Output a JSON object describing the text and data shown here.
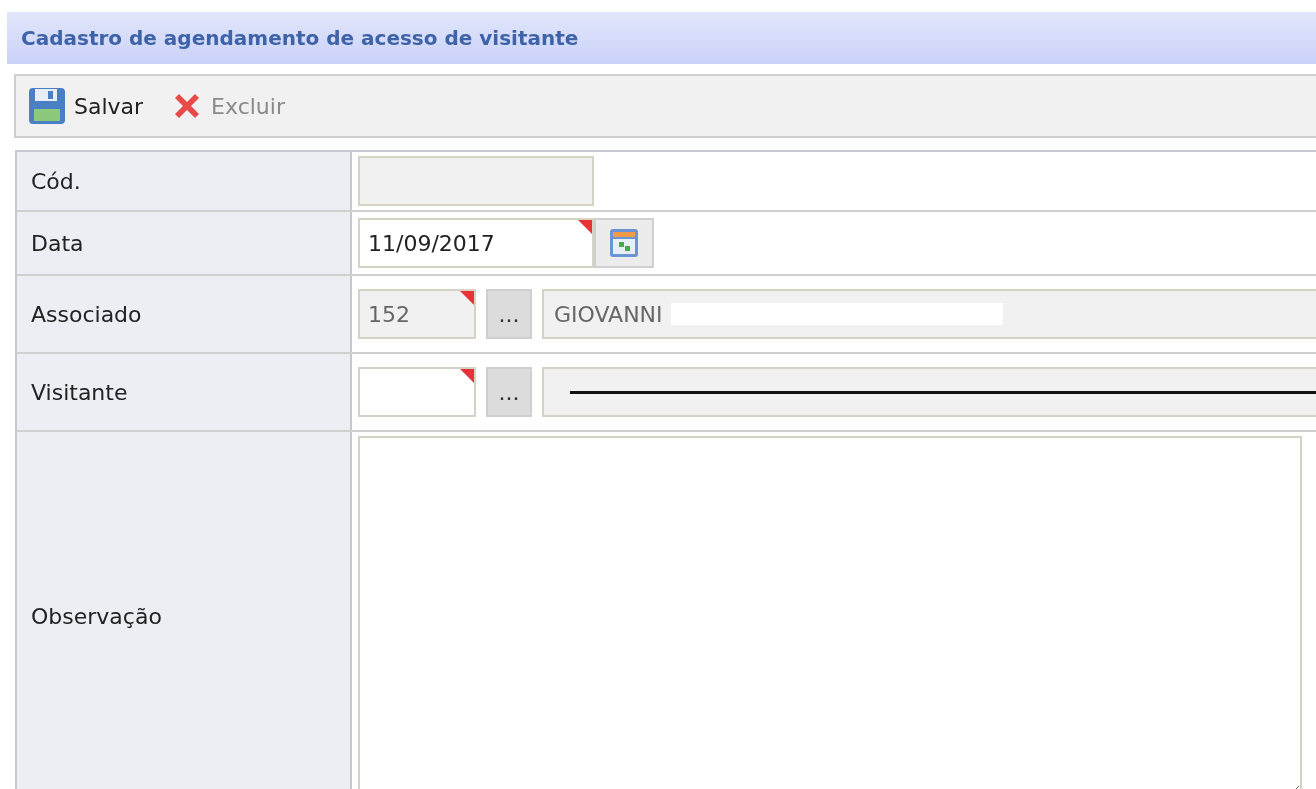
{
  "title": "Cadastro de agendamento de acesso de visitante",
  "toolbar": [
    {
      "label": "Salvar",
      "kind": "save",
      "disabled": false
    },
    {
      "label": "Excluir",
      "kind": "delete",
      "disabled": true
    }
  ],
  "fields": [
    {
      "label": "Cód.",
      "kind": "text",
      "disabled": true,
      "required": false
    },
    {
      "label": "Data",
      "kind": "date",
      "value": "11/09/2017",
      "disabled": false,
      "required": true
    },
    {
      "label": "Associado",
      "kind": "lookup",
      "value": "152",
      "disabled": true,
      "required": true,
      "lookup_button": "...",
      "description": "GIOVANNI",
      "redacted": true
    },
    {
      "label": "Visitante",
      "kind": "lookup",
      "disabled": false,
      "required": true,
      "lookup_button": "...",
      "struck": true
    },
    {
      "label": "Observação",
      "kind": "textarea"
    }
  ]
}
